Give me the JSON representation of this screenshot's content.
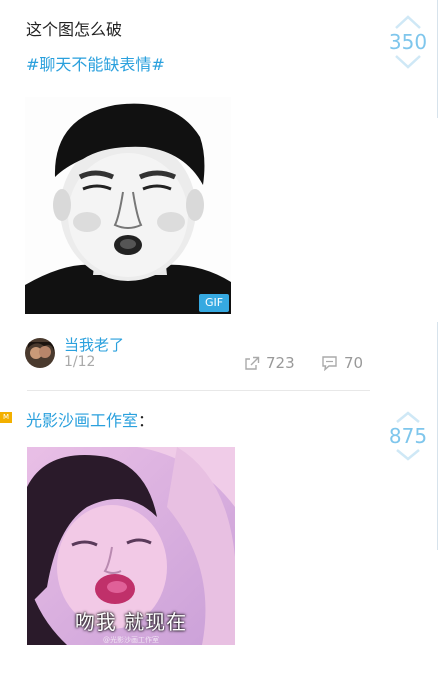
{
  "post1": {
    "title": "这个图怎么破",
    "tag": "#聊天不能缺表情#",
    "votes": "350",
    "image_badge": "GIF",
    "author": "当我老了",
    "page": "1/12",
    "shares": "723",
    "comments": "70"
  },
  "post2": {
    "author": "光影沙画工作室",
    "author_suffix": "：",
    "votes": "875",
    "badge_text": "M",
    "image_caption": "吻我 就现在",
    "image_watermark": "@光影沙画工作室"
  },
  "colors": {
    "accent": "#2aa0dd",
    "vote": "#7fc6ec",
    "badge": "#f3b000"
  },
  "icons": [
    "chevron-up-icon",
    "chevron-down-icon",
    "share-icon",
    "comment-icon"
  ]
}
